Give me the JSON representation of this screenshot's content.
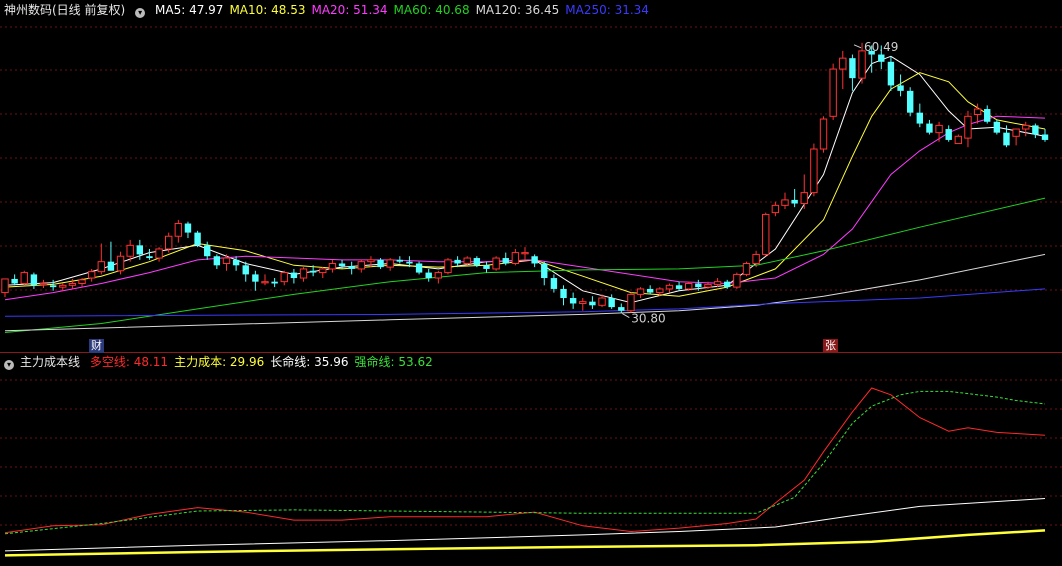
{
  "main_panel": {
    "title": "神州数码(日线 前复权)",
    "ma": [
      {
        "label": "MA5: 47.97",
        "color": "#ffffff"
      },
      {
        "label": "MA10: 48.53",
        "color": "#ffff3a"
      },
      {
        "label": "MA20: 51.34",
        "color": "#ff3cff"
      },
      {
        "label": "MA60: 40.68",
        "color": "#21d321"
      },
      {
        "label": "MA120: 36.45",
        "color": "#d8d8d8"
      },
      {
        "label": "MA250: 31.34",
        "color": "#3a3aff"
      }
    ],
    "badges": {
      "cai": "财",
      "zhang": "张"
    }
  },
  "sub_panel": {
    "title": "主力成本线",
    "items": [
      {
        "label": "多空线: 48.11",
        "color": "#ff2a2a"
      },
      {
        "label": "主力成本: 29.96",
        "color": "#ffff3a"
      },
      {
        "label": "长命线: 35.96",
        "color": "#ffffff"
      },
      {
        "label": "强命线: 53.62",
        "color": "#3ae03a"
      }
    ]
  },
  "chart_data": [
    {
      "type": "candlestick",
      "ylim": [
        28,
        63
      ],
      "annotations": {
        "high_label": "60.49",
        "low_label": "30.80"
      },
      "candles": [
        [
          33,
          34.5,
          32.5,
          34.5
        ],
        [
          34.5,
          35,
          33.8,
          34
        ],
        [
          34,
          35.4,
          33.8,
          35.2
        ],
        [
          35,
          35.2,
          33.4,
          33.8
        ],
        [
          34,
          34.4,
          33.5,
          34
        ],
        [
          33.8,
          34.4,
          33.2,
          33.6
        ],
        [
          33.6,
          34,
          33.2,
          33.8
        ],
        [
          33.8,
          34.5,
          33.4,
          34
        ],
        [
          34,
          34.6,
          33.6,
          34.4
        ],
        [
          34.6,
          35.6,
          34.2,
          35.3
        ],
        [
          35.3,
          38.4,
          35,
          36.4
        ],
        [
          36.4,
          38.6,
          35.8,
          35.4
        ],
        [
          35.4,
          37.5,
          35,
          37
        ],
        [
          37,
          38.8,
          36.4,
          38.2
        ],
        [
          38.2,
          38.8,
          36.6,
          37.2
        ],
        [
          37,
          37.8,
          36.6,
          36.8
        ],
        [
          36.8,
          38,
          36.4,
          37.8
        ],
        [
          37.8,
          39.6,
          37.4,
          39.2
        ],
        [
          39.2,
          41,
          38.5,
          40.6
        ],
        [
          40.6,
          40.8,
          39,
          39.6
        ],
        [
          39.6,
          39.8,
          38,
          38.2
        ],
        [
          38.2,
          38.6,
          36.6,
          37
        ],
        [
          37,
          37.2,
          35.6,
          36
        ],
        [
          36.2,
          37.2,
          35.4,
          36.8
        ],
        [
          36.6,
          37,
          35.4,
          36
        ],
        [
          36,
          36.4,
          34.2,
          35
        ],
        [
          35,
          35.4,
          33.2,
          34.2
        ],
        [
          34.2,
          35,
          33.8,
          34.2
        ],
        [
          34.2,
          34.6,
          33.6,
          34
        ],
        [
          34.2,
          35.4,
          33.8,
          35.2
        ],
        [
          35.2,
          35.6,
          34,
          34.6
        ],
        [
          34.6,
          35.8,
          34.2,
          35.6
        ],
        [
          35.4,
          36,
          34.8,
          35.2
        ],
        [
          35.2,
          35.8,
          34.6,
          35.6
        ],
        [
          35.6,
          36.6,
          35.2,
          36.2
        ],
        [
          36.2,
          36.6,
          35.6,
          35.9
        ],
        [
          35.9,
          36.4,
          35,
          35.6
        ],
        [
          35.6,
          36.6,
          35.2,
          36.4
        ],
        [
          36.4,
          37,
          35.8,
          36.6
        ],
        [
          36.6,
          36.8,
          35.6,
          35.8
        ],
        [
          35.8,
          36.8,
          35.4,
          36.6
        ],
        [
          36.6,
          37,
          36.2,
          36.4
        ],
        [
          36.4,
          37,
          35.8,
          36.2
        ],
        [
          36.2,
          36.4,
          35,
          35.2
        ],
        [
          35.2,
          35.6,
          34.2,
          34.6
        ],
        [
          34.6,
          35.4,
          34,
          35.2
        ],
        [
          35.2,
          36.8,
          35,
          36.6
        ],
        [
          36.6,
          37,
          35.8,
          36.2
        ],
        [
          36.2,
          37,
          36,
          36.8
        ],
        [
          36.8,
          37,
          35.8,
          36
        ],
        [
          36,
          36.4,
          35.2,
          35.6
        ],
        [
          35.6,
          37,
          35.4,
          36.8
        ],
        [
          36.8,
          37.4,
          36,
          36.2
        ],
        [
          36.2,
          37.8,
          36,
          37.4
        ],
        [
          37.4,
          38,
          36.6,
          37.4
        ],
        [
          37,
          37.2,
          35.8,
          36.2
        ],
        [
          36.2,
          36.4,
          33.8,
          34.6
        ],
        [
          34.6,
          35,
          33,
          33.4
        ],
        [
          33.4,
          33.8,
          31.6,
          32.4
        ],
        [
          32.4,
          33,
          31.2,
          31.8
        ],
        [
          31.8,
          32.4,
          31,
          32
        ],
        [
          32,
          32.6,
          31.2,
          31.6
        ],
        [
          31.6,
          32.8,
          31.4,
          32.4
        ],
        [
          32.4,
          32.8,
          31.2,
          31.4
        ],
        [
          31.4,
          31.8,
          30.8,
          31
        ],
        [
          31,
          33,
          30.8,
          32.8
        ],
        [
          32.8,
          33.6,
          32.4,
          33.4
        ],
        [
          33.4,
          33.8,
          32.8,
          33
        ],
        [
          33,
          33.6,
          32.6,
          33.4
        ],
        [
          33.4,
          34,
          33,
          33.8
        ],
        [
          33.8,
          34.2,
          33.2,
          33.4
        ],
        [
          33.4,
          34.2,
          33.2,
          34
        ],
        [
          34,
          34.4,
          33.2,
          33.6
        ],
        [
          33.6,
          34.2,
          33.4,
          33.9
        ],
        [
          33.9,
          34.6,
          33.6,
          34.2
        ],
        [
          34.2,
          34.4,
          33.4,
          33.6
        ],
        [
          33.6,
          35.2,
          33.4,
          35
        ],
        [
          35,
          36.4,
          34.8,
          36.2
        ],
        [
          36.2,
          37.6,
          35.8,
          37.2
        ],
        [
          37.2,
          41.8,
          37,
          41.6
        ],
        [
          41.8,
          43,
          41.4,
          42.6
        ],
        [
          42.6,
          44,
          42.2,
          43.2
        ],
        [
          43.2,
          44.4,
          42.4,
          42.8
        ],
        [
          42.8,
          46,
          42.2,
          44
        ],
        [
          44,
          49.4,
          43.6,
          48.8
        ],
        [
          48.8,
          52.4,
          48.4,
          52.1
        ],
        [
          52.4,
          58.2,
          52,
          57.6
        ],
        [
          57.6,
          59.6,
          55.4,
          58.8
        ],
        [
          58.8,
          59.2,
          55.2,
          56.6
        ],
        [
          56.6,
          60.49,
          56,
          59.6
        ],
        [
          59.6,
          60.2,
          57.2,
          59.2
        ],
        [
          59.2,
          60.2,
          57.6,
          58.4
        ],
        [
          58.4,
          59,
          55.2,
          55.8
        ],
        [
          55.8,
          57,
          54.6,
          55.2
        ],
        [
          55.2,
          55.6,
          52.4,
          52.8
        ],
        [
          52.8,
          53.8,
          51.2,
          51.6
        ],
        [
          51.6,
          52,
          50.4,
          50.6
        ],
        [
          50.6,
          51.8,
          49.6,
          51.4
        ],
        [
          51,
          51.4,
          49.6,
          49.8
        ],
        [
          49.4,
          50.4,
          49.6,
          50.2
        ],
        [
          50,
          53,
          49,
          52.4
        ],
        [
          52.6,
          53.8,
          51.6,
          53.2
        ],
        [
          53.2,
          53.6,
          51.6,
          51.8
        ],
        [
          51.8,
          52,
          50.4,
          50.6
        ],
        [
          50.6,
          51.4,
          49,
          49.2
        ],
        [
          50.2,
          51,
          49.2,
          51
        ],
        [
          51,
          51.8,
          50.2,
          51.4
        ],
        [
          51.4,
          51.6,
          50,
          50.4
        ],
        [
          50.4,
          51,
          49.6,
          49.8
        ]
      ],
      "series": [
        {
          "name": "MA5",
          "color": "#ffffff",
          "x": [
            0,
            5,
            10,
            15,
            20,
            25,
            30,
            35,
            40,
            45,
            50,
            55,
            60,
            65,
            70,
            75,
            80,
            85,
            88,
            90,
            92,
            95,
            98,
            100,
            103,
            108
          ],
          "y": [
            33.8,
            34.1,
            35.6,
            37.4,
            38.2,
            36.2,
            35,
            35.8,
            36.2,
            35.6,
            36.4,
            36.6,
            33.2,
            31.9,
            33.2,
            33.8,
            37.8,
            46,
            55,
            58.2,
            59,
            57,
            53,
            51,
            51.2,
            50.2
          ]
        },
        {
          "name": "MA10",
          "color": "#ffff3a",
          "x": [
            0,
            5,
            10,
            15,
            20,
            25,
            30,
            35,
            40,
            45,
            50,
            55,
            60,
            65,
            70,
            75,
            80,
            85,
            88,
            90,
            92,
            95,
            98,
            100,
            103,
            108
          ],
          "y": [
            33.6,
            33.9,
            34.8,
            36.4,
            38.4,
            37.6,
            36,
            35.6,
            36,
            35.8,
            36,
            36.6,
            34.8,
            33,
            32.6,
            33.6,
            35.6,
            41,
            48,
            52.4,
            55.4,
            57.2,
            56.2,
            54,
            52,
            51
          ]
        },
        {
          "name": "MA20",
          "color": "#ff3cff",
          "x": [
            0,
            5,
            10,
            15,
            20,
            25,
            30,
            35,
            40,
            45,
            50,
            55,
            60,
            65,
            70,
            75,
            80,
            85,
            88,
            90,
            92,
            95,
            98,
            100,
            103,
            108
          ],
          "y": [
            32.2,
            33,
            34,
            35.2,
            36.6,
            37,
            36.8,
            36.6,
            36.6,
            36.4,
            36.4,
            36.6,
            35.8,
            35,
            34.2,
            34,
            34.6,
            37.2,
            40,
            43,
            46,
            48.6,
            50.6,
            51.5,
            52.4,
            52.2
          ]
        },
        {
          "name": "MA60",
          "color": "#21d321",
          "x": [
            0,
            10,
            20,
            30,
            40,
            50,
            60,
            70,
            78,
            85,
            95,
            108
          ],
          "y": [
            28.6,
            29.6,
            31.2,
            32.8,
            34.2,
            35.2,
            35.5,
            35.6,
            36,
            37.6,
            40.2,
            43.4
          ]
        },
        {
          "name": "MA120",
          "color": "#d8d8d8",
          "x": [
            0,
            20,
            40,
            60,
            70,
            78,
            85,
            95,
            108
          ],
          "y": [
            28.8,
            29.4,
            30,
            30.6,
            31,
            31.6,
            32.6,
            34.4,
            37.2
          ]
        },
        {
          "name": "MA250",
          "color": "#3a3aff",
          "x": [
            0,
            40,
            60,
            70,
            80,
            95,
            108
          ],
          "y": [
            30.4,
            30.6,
            30.9,
            31.2,
            31.8,
            32.4,
            33.4
          ]
        }
      ]
    },
    {
      "type": "line",
      "ylim": [
        27,
        60
      ],
      "series": [
        {
          "name": "多空线",
          "color": "#ff2a2a",
          "x": [
            0,
            5,
            10,
            15,
            20,
            25,
            30,
            35,
            40,
            45,
            50,
            55,
            60,
            65,
            70,
            75,
            78,
            80,
            83,
            85,
            88,
            90,
            92,
            95,
            98,
            100,
            103,
            105,
            108
          ],
          "y": [
            31.8,
            33,
            33.2,
            35,
            36.2,
            35.4,
            34,
            34,
            34.6,
            34.6,
            34.6,
            35.4,
            33,
            32,
            32.6,
            33.4,
            34.2,
            37,
            41,
            46,
            53,
            57.2,
            56,
            52,
            49.6,
            50.2,
            49.4,
            49.2,
            48.9
          ]
        },
        {
          "name": "主力成本",
          "color": "#ffff3a",
          "x": [
            0,
            20,
            40,
            60,
            78,
            90,
            100,
            108
          ],
          "y": [
            27.8,
            28.4,
            28.9,
            29.3,
            29.6,
            30.2,
            31.4,
            32.2
          ]
        },
        {
          "name": "长命线",
          "color": "#ffffff",
          "x": [
            0,
            20,
            40,
            60,
            70,
            80,
            88,
            95,
            108
          ],
          "y": [
            28.6,
            29.6,
            30.4,
            31.4,
            32,
            32.8,
            34.8,
            36.4,
            37.8
          ]
        },
        {
          "name": "强命线",
          "color": "#3ae03a",
          "x": [
            0,
            10,
            20,
            30,
            40,
            50,
            60,
            70,
            78,
            82,
            85,
            88,
            90,
            93,
            95,
            98,
            100,
            103,
            105,
            108
          ],
          "y": [
            31.6,
            33.4,
            35.6,
            35.8,
            35.6,
            35.4,
            35.2,
            35.2,
            35.2,
            38,
            44,
            51,
            54,
            56,
            56.6,
            56.6,
            56.2,
            55.6,
            55,
            54.4
          ]
        }
      ]
    }
  ]
}
